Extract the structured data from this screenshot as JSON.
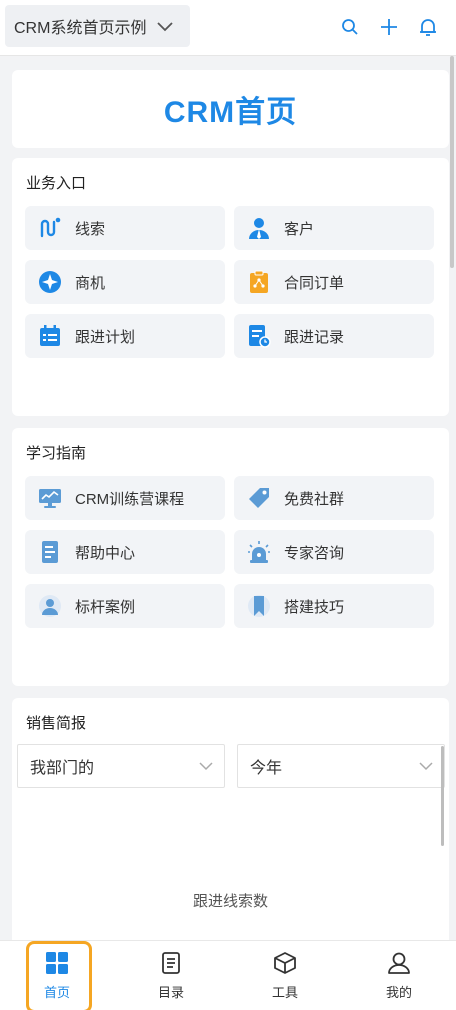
{
  "header": {
    "app_name": "CRM系统首页示例",
    "icons": [
      "search-icon",
      "plus-icon",
      "bell-icon"
    ]
  },
  "hero": {
    "title": "CRM首页"
  },
  "business": {
    "title": "业务入口",
    "items": [
      {
        "label": "线索",
        "icon": "route-icon"
      },
      {
        "label": "客户",
        "icon": "user-icon"
      },
      {
        "label": "商机",
        "icon": "compass-icon"
      },
      {
        "label": "合同订单",
        "icon": "clipboard-icon"
      },
      {
        "label": "跟进计划",
        "icon": "calendar-list-icon"
      },
      {
        "label": "跟进记录",
        "icon": "record-clock-icon"
      }
    ]
  },
  "learning": {
    "title": "学习指南",
    "items": [
      {
        "label": "CRM训练营课程",
        "icon": "monitor-icon"
      },
      {
        "label": "免费社群",
        "icon": "tag-icon"
      },
      {
        "label": "帮助中心",
        "icon": "document-icon"
      },
      {
        "label": "专家咨询",
        "icon": "alarm-light-icon"
      },
      {
        "label": "标杆案例",
        "icon": "person-icon"
      },
      {
        "label": "搭建技巧",
        "icon": "bookmark-icon"
      }
    ]
  },
  "sales": {
    "title": "销售简报",
    "filter_scope": "我部门的",
    "filter_period": "今年",
    "metric_label": "跟进线索数"
  },
  "tabs": [
    {
      "label": "首页",
      "icon": "grid-icon",
      "active": true
    },
    {
      "label": "目录",
      "icon": "list-icon",
      "active": false
    },
    {
      "label": "工具",
      "icon": "box-icon",
      "active": false
    },
    {
      "label": "我的",
      "icon": "profile-icon",
      "active": false
    }
  ],
  "colors": {
    "accent": "#1e88e5",
    "orange": "#f5a623",
    "page_bg": "#f2f3f5"
  }
}
